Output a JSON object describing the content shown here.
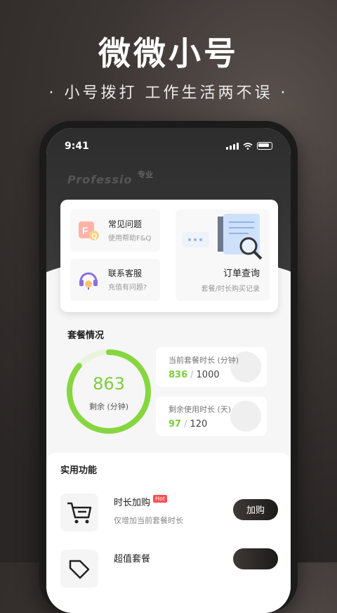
{
  "hero": {
    "title": "微微小号",
    "subtitle": "· 小号拨打 工作生活两不误 ·"
  },
  "status_bar": {
    "time": "9:41"
  },
  "watermark": {
    "en": "Professio",
    "cn": "专业"
  },
  "services": {
    "faq": {
      "title": "常见问题",
      "desc": "使用帮助F&Q"
    },
    "contact": {
      "title": "联系客服",
      "desc": "充值有问题?"
    },
    "order": {
      "title": "订单查询",
      "desc": "套餐/时长购买记录"
    }
  },
  "package": {
    "section_title": "套餐情况",
    "remaining": "863",
    "remaining_label": "剩余 (分钟)",
    "ring_fraction": 0.863,
    "current": {
      "label": "当前套餐时长 (分钟)",
      "value": "836",
      "total": "1000"
    },
    "left": {
      "label": "剩余使用时长 (天)",
      "value": "97",
      "total": "120"
    }
  },
  "features": {
    "section_title": "实用功能",
    "items": [
      {
        "title": "时长加购",
        "badge": "Hot",
        "desc": "仅增加当前套餐时长",
        "button": "加购"
      },
      {
        "title": "超值套餐",
        "badge": "",
        "desc": "",
        "button": ""
      }
    ]
  },
  "colors": {
    "accent_green": "#7ccf3a",
    "dark": "#2d2d2d"
  }
}
